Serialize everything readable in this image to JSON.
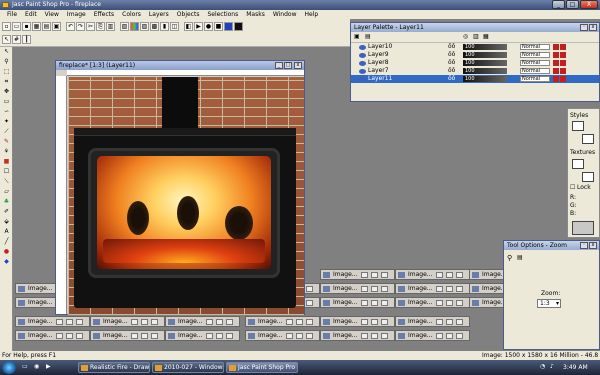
{
  "app": {
    "title": "Jasc Paint Shop Pro - fireplace",
    "window_buttons": {
      "minimize": "_",
      "maximize": "□",
      "close": "X"
    }
  },
  "menu": [
    "File",
    "Edit",
    "View",
    "Image",
    "Effects",
    "Colors",
    "Layers",
    "Objects",
    "Selections",
    "Masks",
    "Window",
    "Help"
  ],
  "image_window": {
    "title": "fireplace* [1:3] (Layer11)"
  },
  "layer_palette": {
    "title": "Layer Palette - Layer11",
    "layers": [
      {
        "name": "Layer10",
        "opacity": "100",
        "blend": "Normal",
        "selected": false
      },
      {
        "name": "Layer9",
        "opacity": "100",
        "blend": "Normal",
        "selected": false
      },
      {
        "name": "Layer8",
        "opacity": "100",
        "blend": "Normal",
        "selected": false
      },
      {
        "name": "Layer7",
        "opacity": "100",
        "blend": "Normal",
        "selected": false
      },
      {
        "name": "Layer11",
        "opacity": "100",
        "blend": "Normal",
        "selected": true
      }
    ],
    "eye_glyph": "ôô"
  },
  "styles_palette": {
    "styles_label": "Styles",
    "textures_label": "Textures",
    "lock_label": "Lock",
    "rgb_labels": [
      "R:",
      "G:",
      "B:"
    ]
  },
  "tool_options": {
    "title": "Tool Options - Zoom",
    "zoom_label": "Zoom:",
    "zoom_value": "1:3"
  },
  "thumbnails": {
    "label": "Image..."
  },
  "status": {
    "left": "For Help, press F1",
    "right": "Image: 1500 x 1580 x 16 Million - 46.8 MBytes"
  },
  "taskbar": {
    "tasks": [
      {
        "label": "Realistic Fire - Draw...",
        "active": false
      },
      {
        "label": "2010-027 - Windows...",
        "active": false
      },
      {
        "label": "Jasc Paint Shop Pro ...",
        "active": true
      }
    ],
    "clock": "3:49 AM"
  },
  "colors": {
    "titlebar": "#3b4f7a",
    "selection": "#316ac5",
    "brick": "#a5603e",
    "fire_core": "#ffd060"
  }
}
